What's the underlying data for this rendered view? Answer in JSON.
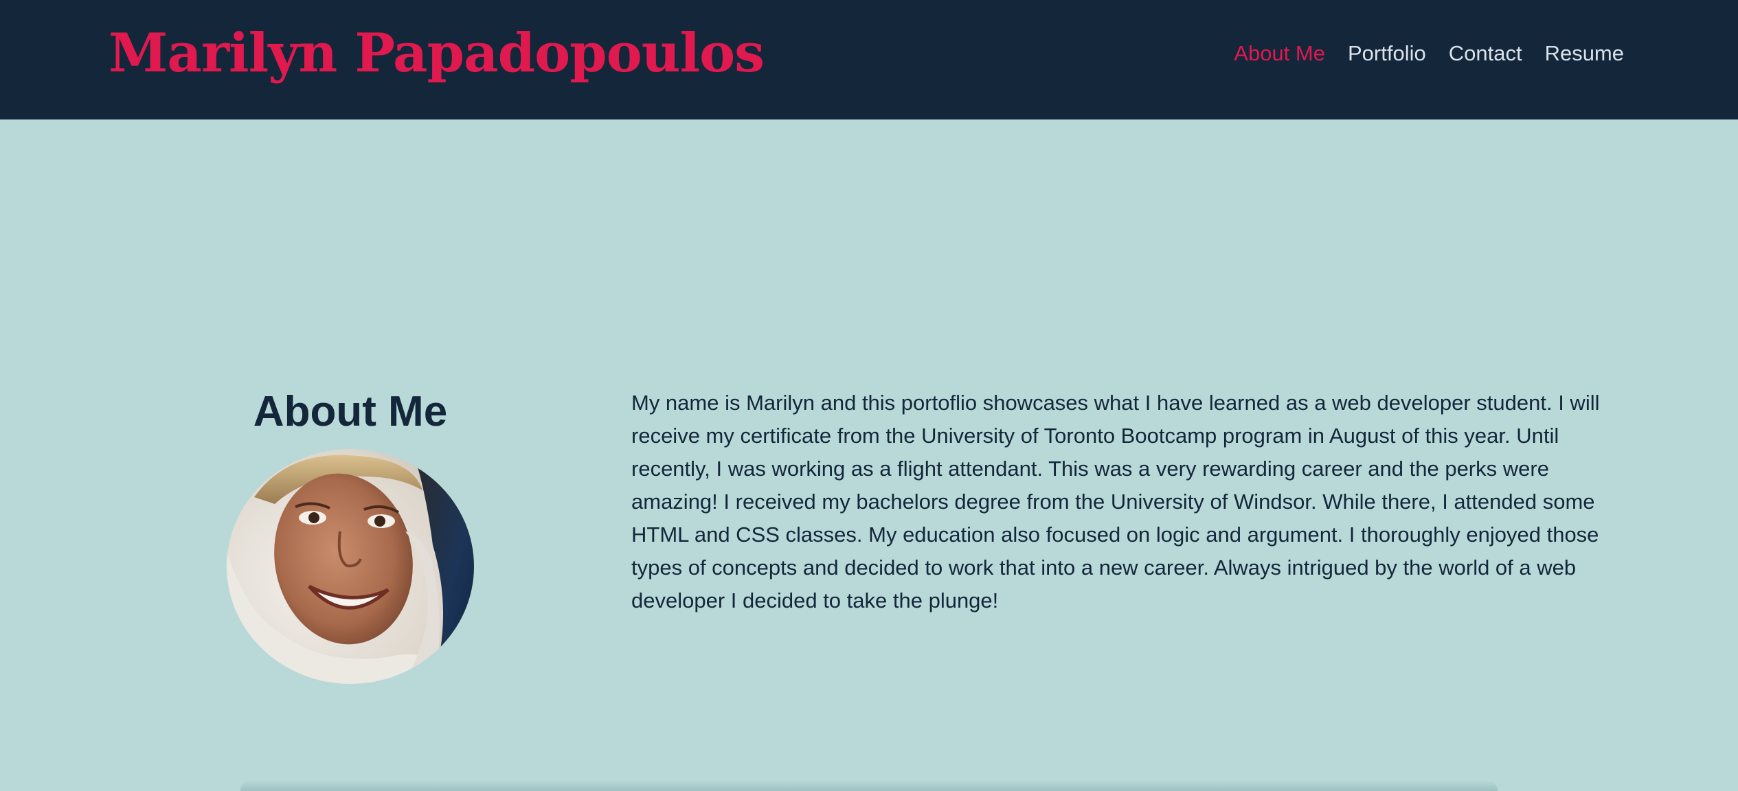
{
  "header": {
    "brand": "Marilyn Papadopoulos",
    "nav": [
      {
        "label": "About Me",
        "active": true
      },
      {
        "label": "Portfolio",
        "active": false
      },
      {
        "label": "Contact",
        "active": false
      },
      {
        "label": "Resume",
        "active": false
      }
    ]
  },
  "about": {
    "title": "About Me",
    "avatar_icon": "profile-photo",
    "bio": "My name is Marilyn and this portoflio showcases what I have learned as a web developer student. I will receive my certificate from the University of Toronto Bootcamp program in August of this year. Until recently, I was working as a flight attendant. This was a very rewarding career and the perks were amazing! I received my bachelors degree from the University of Windsor. While there, I attended some HTML and CSS classes. My education also focused on logic and argument. I thoroughly enjoyed those types of concepts and decided to work that into a new career. Always intrigued by the world of a web developer I decided to take the plunge!"
  },
  "colors": {
    "header_bg": "#13263a",
    "accent": "#e0194f",
    "page_bg": "#b8d9d8",
    "text": "#13263a",
    "nav_text": "#d9e2ea"
  }
}
